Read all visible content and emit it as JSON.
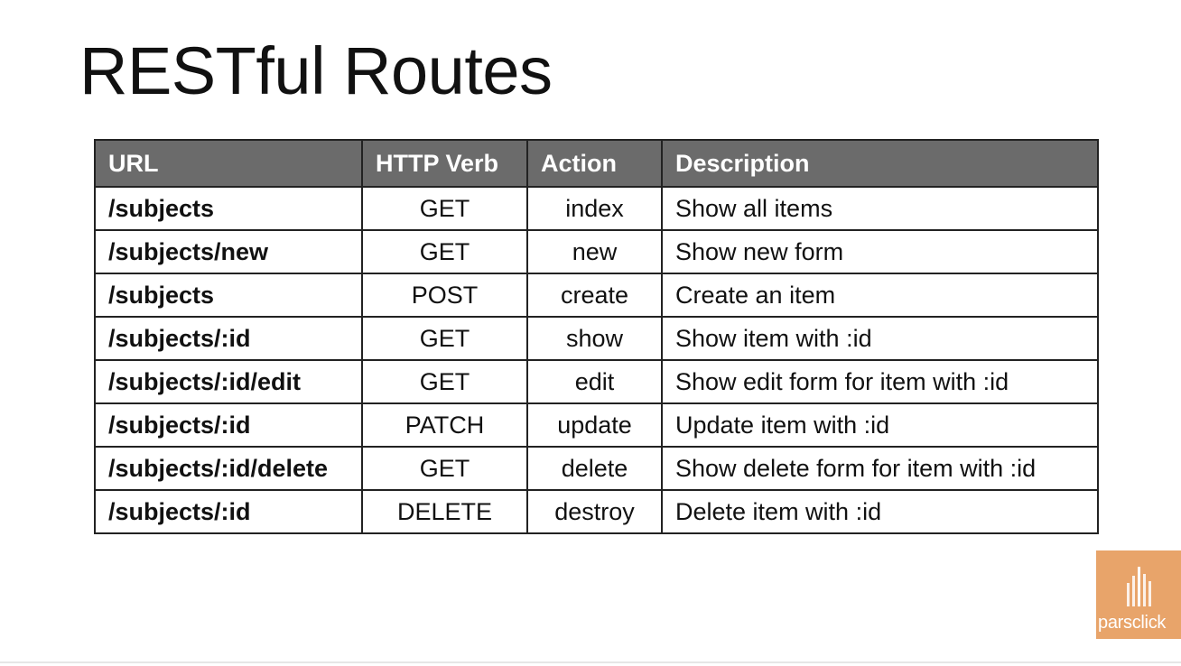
{
  "slide": {
    "title": "RESTful Routes"
  },
  "table": {
    "headers": {
      "url": "URL",
      "verb": "HTTP Verb",
      "action": "Action",
      "description": "Description"
    },
    "rows": [
      {
        "url": "/subjects",
        "verb": "GET",
        "action": "index",
        "description": "Show all items"
      },
      {
        "url": "/subjects/new",
        "verb": "GET",
        "action": "new",
        "description": "Show new form"
      },
      {
        "url": "/subjects",
        "verb": "POST",
        "action": "create",
        "description": "Create an item"
      },
      {
        "url": "/subjects/:id",
        "verb": "GET",
        "action": "show",
        "description": "Show item with :id"
      },
      {
        "url": "/subjects/:id/edit",
        "verb": "GET",
        "action": "edit",
        "description": "Show edit form for item with :id"
      },
      {
        "url": "/subjects/:id",
        "verb": "PATCH",
        "action": "update",
        "description": "Update item with :id"
      },
      {
        "url": "/subjects/:id/delete",
        "verb": "GET",
        "action": "delete",
        "description": "Show delete form for item with :id"
      },
      {
        "url": "/subjects/:id",
        "verb": "DELETE",
        "action": "destroy",
        "description": "Delete item with :id"
      }
    ]
  },
  "logo": {
    "text": "parsclick",
    "background_color": "#e8a46a",
    "icon": "parsclick-mark-icon"
  },
  "colors": {
    "header_background": "#6b6b6b",
    "header_text": "#ffffff",
    "border": "#222222"
  }
}
